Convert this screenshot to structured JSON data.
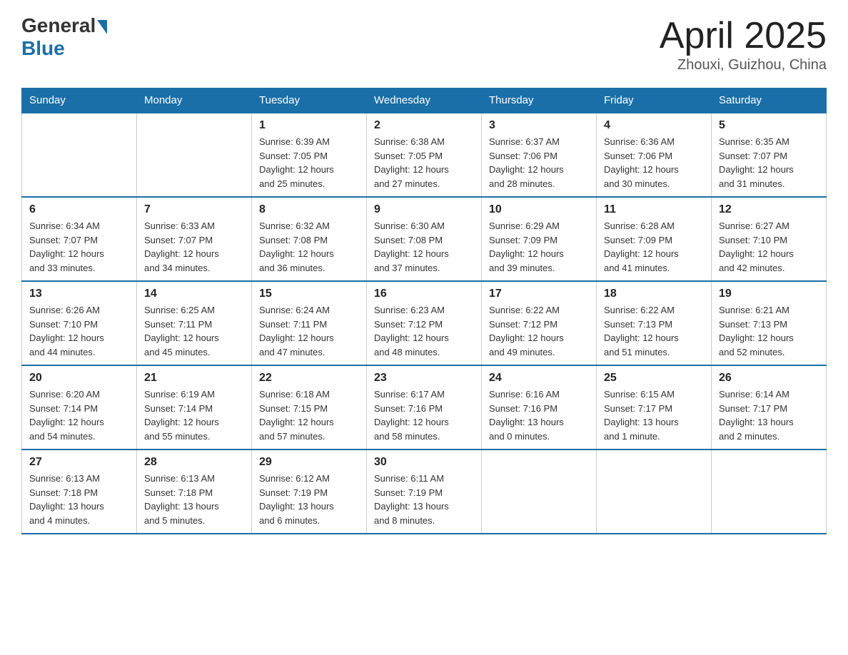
{
  "logo": {
    "general": "General",
    "blue": "Blue"
  },
  "title": {
    "month_year": "April 2025",
    "location": "Zhouxi, Guizhou, China"
  },
  "headers": [
    "Sunday",
    "Monday",
    "Tuesday",
    "Wednesday",
    "Thursday",
    "Friday",
    "Saturday"
  ],
  "weeks": [
    [
      {
        "day": "",
        "info": ""
      },
      {
        "day": "",
        "info": ""
      },
      {
        "day": "1",
        "info": "Sunrise: 6:39 AM\nSunset: 7:05 PM\nDaylight: 12 hours\nand 25 minutes."
      },
      {
        "day": "2",
        "info": "Sunrise: 6:38 AM\nSunset: 7:05 PM\nDaylight: 12 hours\nand 27 minutes."
      },
      {
        "day": "3",
        "info": "Sunrise: 6:37 AM\nSunset: 7:06 PM\nDaylight: 12 hours\nand 28 minutes."
      },
      {
        "day": "4",
        "info": "Sunrise: 6:36 AM\nSunset: 7:06 PM\nDaylight: 12 hours\nand 30 minutes."
      },
      {
        "day": "5",
        "info": "Sunrise: 6:35 AM\nSunset: 7:07 PM\nDaylight: 12 hours\nand 31 minutes."
      }
    ],
    [
      {
        "day": "6",
        "info": "Sunrise: 6:34 AM\nSunset: 7:07 PM\nDaylight: 12 hours\nand 33 minutes."
      },
      {
        "day": "7",
        "info": "Sunrise: 6:33 AM\nSunset: 7:07 PM\nDaylight: 12 hours\nand 34 minutes."
      },
      {
        "day": "8",
        "info": "Sunrise: 6:32 AM\nSunset: 7:08 PM\nDaylight: 12 hours\nand 36 minutes."
      },
      {
        "day": "9",
        "info": "Sunrise: 6:30 AM\nSunset: 7:08 PM\nDaylight: 12 hours\nand 37 minutes."
      },
      {
        "day": "10",
        "info": "Sunrise: 6:29 AM\nSunset: 7:09 PM\nDaylight: 12 hours\nand 39 minutes."
      },
      {
        "day": "11",
        "info": "Sunrise: 6:28 AM\nSunset: 7:09 PM\nDaylight: 12 hours\nand 41 minutes."
      },
      {
        "day": "12",
        "info": "Sunrise: 6:27 AM\nSunset: 7:10 PM\nDaylight: 12 hours\nand 42 minutes."
      }
    ],
    [
      {
        "day": "13",
        "info": "Sunrise: 6:26 AM\nSunset: 7:10 PM\nDaylight: 12 hours\nand 44 minutes."
      },
      {
        "day": "14",
        "info": "Sunrise: 6:25 AM\nSunset: 7:11 PM\nDaylight: 12 hours\nand 45 minutes."
      },
      {
        "day": "15",
        "info": "Sunrise: 6:24 AM\nSunset: 7:11 PM\nDaylight: 12 hours\nand 47 minutes."
      },
      {
        "day": "16",
        "info": "Sunrise: 6:23 AM\nSunset: 7:12 PM\nDaylight: 12 hours\nand 48 minutes."
      },
      {
        "day": "17",
        "info": "Sunrise: 6:22 AM\nSunset: 7:12 PM\nDaylight: 12 hours\nand 49 minutes."
      },
      {
        "day": "18",
        "info": "Sunrise: 6:22 AM\nSunset: 7:13 PM\nDaylight: 12 hours\nand 51 minutes."
      },
      {
        "day": "19",
        "info": "Sunrise: 6:21 AM\nSunset: 7:13 PM\nDaylight: 12 hours\nand 52 minutes."
      }
    ],
    [
      {
        "day": "20",
        "info": "Sunrise: 6:20 AM\nSunset: 7:14 PM\nDaylight: 12 hours\nand 54 minutes."
      },
      {
        "day": "21",
        "info": "Sunrise: 6:19 AM\nSunset: 7:14 PM\nDaylight: 12 hours\nand 55 minutes."
      },
      {
        "day": "22",
        "info": "Sunrise: 6:18 AM\nSunset: 7:15 PM\nDaylight: 12 hours\nand 57 minutes."
      },
      {
        "day": "23",
        "info": "Sunrise: 6:17 AM\nSunset: 7:16 PM\nDaylight: 12 hours\nand 58 minutes."
      },
      {
        "day": "24",
        "info": "Sunrise: 6:16 AM\nSunset: 7:16 PM\nDaylight: 13 hours\nand 0 minutes."
      },
      {
        "day": "25",
        "info": "Sunrise: 6:15 AM\nSunset: 7:17 PM\nDaylight: 13 hours\nand 1 minute."
      },
      {
        "day": "26",
        "info": "Sunrise: 6:14 AM\nSunset: 7:17 PM\nDaylight: 13 hours\nand 2 minutes."
      }
    ],
    [
      {
        "day": "27",
        "info": "Sunrise: 6:13 AM\nSunset: 7:18 PM\nDaylight: 13 hours\nand 4 minutes."
      },
      {
        "day": "28",
        "info": "Sunrise: 6:13 AM\nSunset: 7:18 PM\nDaylight: 13 hours\nand 5 minutes."
      },
      {
        "day": "29",
        "info": "Sunrise: 6:12 AM\nSunset: 7:19 PM\nDaylight: 13 hours\nand 6 minutes."
      },
      {
        "day": "30",
        "info": "Sunrise: 6:11 AM\nSunset: 7:19 PM\nDaylight: 13 hours\nand 8 minutes."
      },
      {
        "day": "",
        "info": ""
      },
      {
        "day": "",
        "info": ""
      },
      {
        "day": "",
        "info": ""
      }
    ]
  ]
}
